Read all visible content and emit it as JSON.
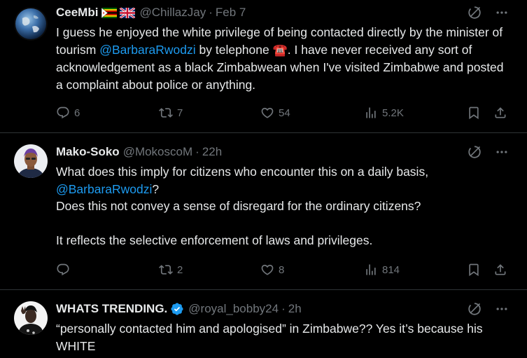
{
  "tweets": [
    {
      "name": "CeeMbi",
      "handle": "@ChillazJay",
      "dot": "·",
      "time": "Feb 7",
      "text_p1": "I guess he enjoyed the white privilege of being contacted directly by the minister of tourism ",
      "mention": "@BarbaraRwodzi",
      "text_p2": " by telephone ",
      "phone_emoji": "☎️",
      "text_p3": ".  I have never received any sort of acknowledgement as a black Zimbabwean when I've visited Zimbabwe and posted a complaint about police or anything.",
      "replies": "6",
      "reposts": "7",
      "likes": "54",
      "views": "5.2K"
    },
    {
      "name": "Mako-Soko",
      "handle": "@MokoscoM",
      "dot": "·",
      "time": "22h",
      "line1": "What does this imply for citizens who encounter this on a daily basis,",
      "mention": "@BarbaraRwodzi",
      "line2_suffix": "?",
      "line3": "Does this not convey a sense of disregard for the ordinary citizens?",
      "line4": "It reflects the selective enforcement of laws and privileges.",
      "replies": "",
      "reposts": "2",
      "likes": "8",
      "views": "814"
    },
    {
      "name": "WHATS TRENDING.",
      "handle": "@royal_bobby24",
      "dot": "·",
      "time": "2h",
      "text": "“personally contacted him and apologised” in Zimbabwe?? Yes it’s because his WHITE"
    }
  ],
  "colors": {
    "background": "#000000",
    "text": "#e7e9ea",
    "muted": "#71767b",
    "link": "#1d9bf0",
    "divider": "#2f3336",
    "verified": "#1d9bf0"
  },
  "icons": [
    "grok-icon",
    "more-icon",
    "reply-icon",
    "repost-icon",
    "like-icon",
    "views-icon",
    "bookmark-icon",
    "share-icon",
    "verified-badge-icon",
    "zimbabwe-flag-icon",
    "uk-flag-icon"
  ]
}
